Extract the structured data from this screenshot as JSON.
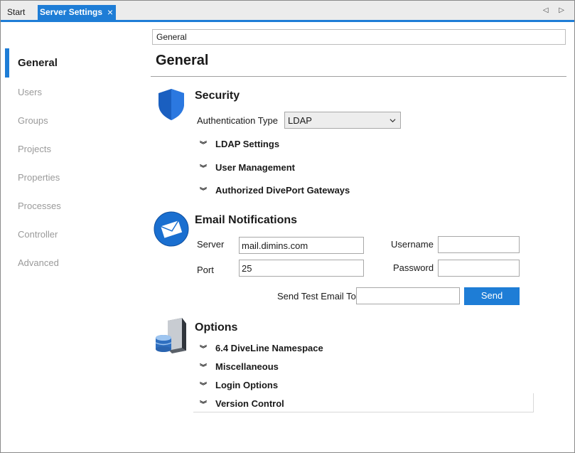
{
  "tabs": {
    "start": "Start",
    "active": "Server Settings",
    "close": "×",
    "arrows": "◁ ▷"
  },
  "sidebar": {
    "items": [
      "General",
      "Users",
      "Groups",
      "Projects",
      "Properties",
      "Processes",
      "Controller",
      "Advanced"
    ],
    "active": "General"
  },
  "breadcrumb": "General",
  "page_title": "General",
  "security": {
    "title": "Security",
    "auth_label": "Authentication Type",
    "auth_value": "LDAP",
    "expanders": [
      "LDAP Settings",
      "User Management",
      "Authorized DivePort Gateways"
    ]
  },
  "email": {
    "title": "Email Notifications",
    "server_label": "Server",
    "server_value": "mail.dimins.com",
    "port_label": "Port",
    "port_value": "25",
    "username_label": "Username",
    "username_value": "",
    "password_label": "Password",
    "password_value": "",
    "test_label": "Send Test Email To",
    "test_value": "",
    "send_button": "Send"
  },
  "options": {
    "title": "Options",
    "expanders": [
      "6.4 DiveLine Namespace",
      "Miscellaneous",
      "Login Options",
      "Version Control"
    ]
  },
  "colors": {
    "accent": "#1e7dd6"
  }
}
